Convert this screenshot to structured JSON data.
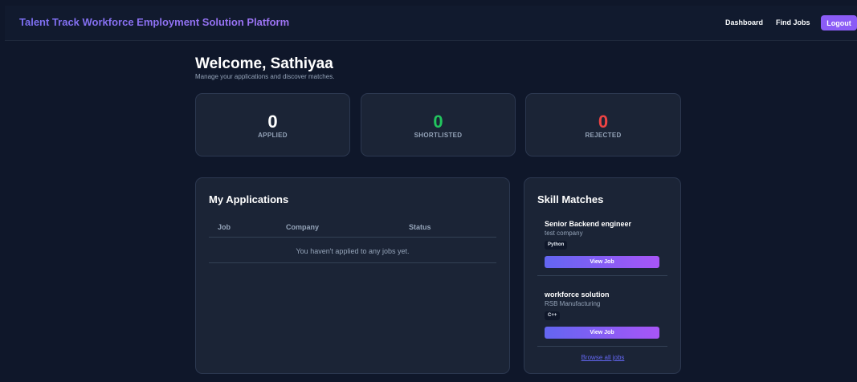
{
  "header": {
    "brand": "Talent Track Workforce Employment Solution Platform",
    "nav": {
      "dashboard": "Dashboard",
      "find_jobs": "Find Jobs",
      "logout": "Logout"
    }
  },
  "welcome": {
    "title": "Welcome, Sathiyaa",
    "subtitle": "Manage your applications and discover matches."
  },
  "stats": [
    {
      "value": "0",
      "label": "APPLIED",
      "color": "#ffffff"
    },
    {
      "value": "0",
      "label": "SHORTLISTED",
      "color": "#22c55e"
    },
    {
      "value": "0",
      "label": "REJECTED",
      "color": "#ef4444"
    }
  ],
  "applications": {
    "title": "My Applications",
    "columns": [
      "Job",
      "Company",
      "Status"
    ],
    "empty_message": "You haven't applied to any jobs yet."
  },
  "skill_matches": {
    "title": "Skill Matches",
    "items": [
      {
        "title": "Senior Backend engineer",
        "company": "test company",
        "skill": "Python",
        "button": "View Job"
      },
      {
        "title": "workforce solution",
        "company": "RSB Manufacturing",
        "skill": "C++",
        "button": "View Job"
      }
    ],
    "browse_link": "Browse all jobs"
  },
  "colors": {
    "background": "#0f172a",
    "card": "#1b2436",
    "accent": "#8b5cf6",
    "shortlisted": "#22c55e",
    "rejected": "#ef4444"
  }
}
